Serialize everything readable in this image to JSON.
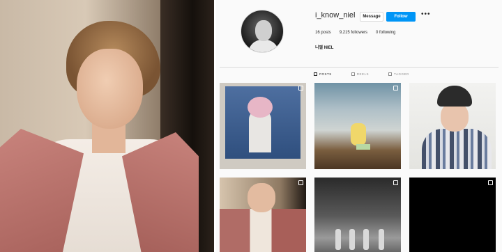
{
  "profile": {
    "username": "i_know_niel",
    "message_label": "Message",
    "follow_label": "Follow",
    "more_label": "•••",
    "stats": {
      "posts": "16 posts",
      "followers": "9,215 followers",
      "following": "0 following"
    },
    "bio_name": "니엘 NIEL"
  },
  "tabs": [
    {
      "label": "POSTS",
      "active": true
    },
    {
      "label": "REELS",
      "active": false
    },
    {
      "label": "TAGGED",
      "active": false
    }
  ],
  "colors": {
    "accent": "#0095f6",
    "text": "#262626",
    "muted": "#8e8e8e"
  }
}
